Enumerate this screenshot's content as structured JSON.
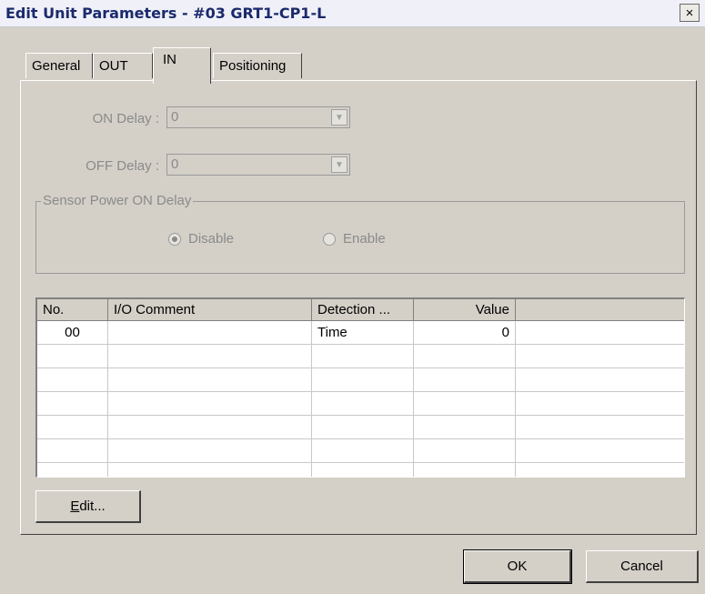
{
  "window": {
    "title": "Edit Unit Parameters - #03 GRT1-CP1-L",
    "close_glyph": "×"
  },
  "tabs": [
    {
      "label": "General"
    },
    {
      "label": "OUT"
    },
    {
      "label": "IN",
      "active": true
    },
    {
      "label": "Positioning"
    }
  ],
  "fields": {
    "on_delay": {
      "label": "ON Delay :",
      "value": "0",
      "enabled": false
    },
    "off_delay": {
      "label": "OFF Delay :",
      "value": "0",
      "enabled": false
    }
  },
  "sensor_power": {
    "title": "Sensor Power ON Delay",
    "options": [
      {
        "label": "Disable",
        "selected": true
      },
      {
        "label": "Enable",
        "selected": false
      }
    ]
  },
  "table": {
    "columns": [
      "No.",
      "I/O Comment",
      "Detection ...",
      "Value",
      ""
    ],
    "rows": [
      [
        "00",
        "",
        "Time",
        "0",
        ""
      ],
      [
        "",
        "",
        "",
        "",
        ""
      ],
      [
        "",
        "",
        "",
        "",
        ""
      ],
      [
        "",
        "",
        "",
        "",
        ""
      ],
      [
        "",
        "",
        "",
        "",
        ""
      ],
      [
        "",
        "",
        "",
        "",
        ""
      ],
      [
        "",
        "",
        "",
        "",
        ""
      ]
    ]
  },
  "buttons": {
    "edit_mnemonic": "E",
    "edit_rest": "dit...",
    "ok": "OK",
    "cancel": "Cancel"
  },
  "colors": {
    "dialog_bg": "#d4d0c8",
    "title_text": "#1a2a6c",
    "disabled_text": "#8a8a8a"
  }
}
